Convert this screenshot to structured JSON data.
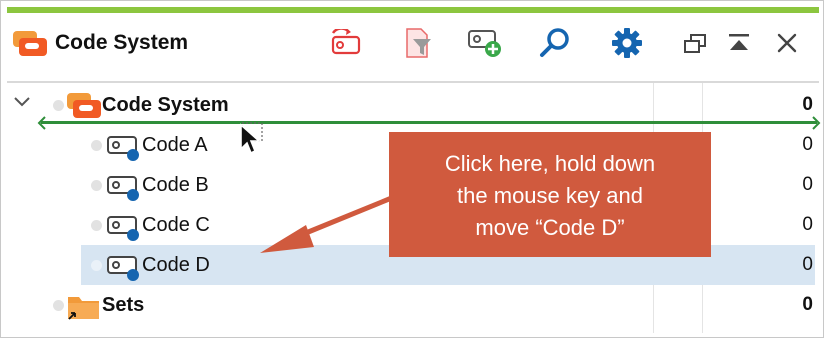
{
  "window": {
    "title": "Code System",
    "accent": "#8cc63f"
  },
  "toolbar": {
    "icons": [
      "activate-codes-icon",
      "filter-document-icon",
      "new-code-icon",
      "search-icon",
      "gear-icon",
      "undock-icon",
      "collapse-icon",
      "close-icon"
    ]
  },
  "tree": {
    "root": {
      "label": "Code System",
      "count": "0"
    },
    "codes": [
      {
        "label": "Code A",
        "count": "0"
      },
      {
        "label": "Code B",
        "count": "0"
      },
      {
        "label": "Code C",
        "count": "0"
      },
      {
        "label": "Code D",
        "count": "0",
        "selected": true
      }
    ],
    "sets": {
      "label": "Sets",
      "count": "0"
    }
  },
  "callout": {
    "line1": "Click here, hold down",
    "line2": "the mouse key and",
    "line3": "move “Code D”",
    "color": "#d05a3e"
  },
  "colors": {
    "selection": "#d7e5f2",
    "drop_indicator": "#2f8e3a",
    "code_icon_dot": "#1565b0",
    "folder": "#f29a3a"
  }
}
